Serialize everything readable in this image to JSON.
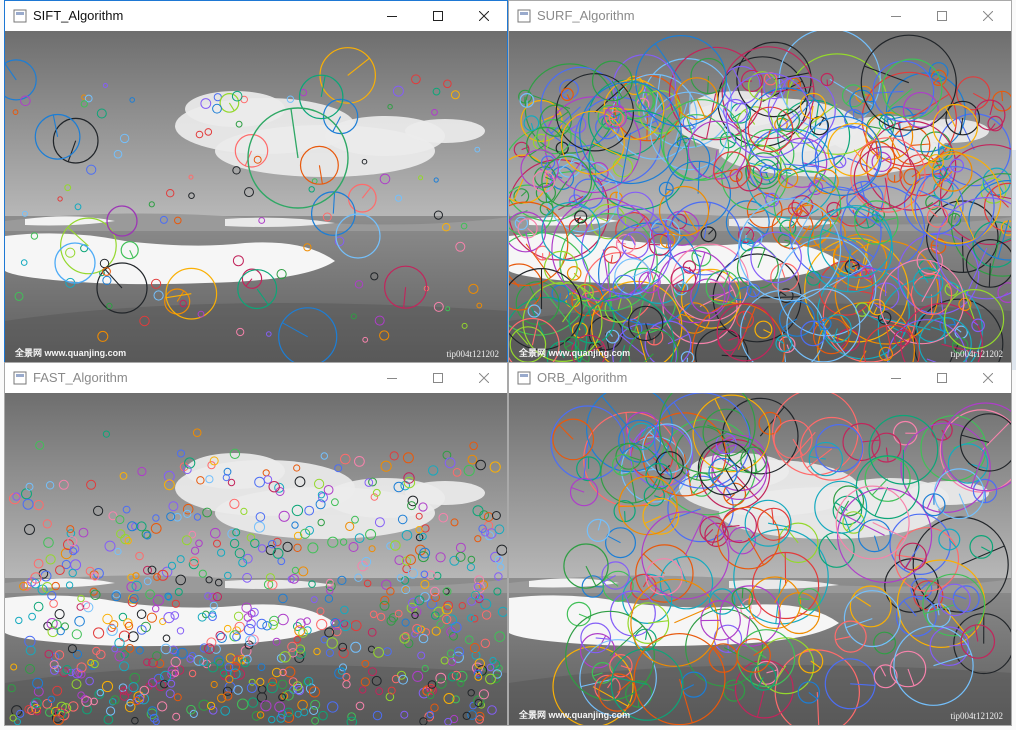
{
  "windows": [
    {
      "key": "sift",
      "title": "SIFT_Algorithm",
      "state": "active",
      "watermark": "全景网 www.quanjing.com",
      "code": "tip004t121202",
      "keypoint_count": 110,
      "keypoint_style": "rich-sparse",
      "seed": 11
    },
    {
      "key": "surf",
      "title": "SURF_Algorithm",
      "state": "inactive",
      "watermark": "全景网 www.quanjing.com",
      "code": "tip004t121202",
      "keypoint_count": 340,
      "keypoint_style": "rich-dense",
      "seed": 23
    },
    {
      "key": "fast",
      "title": "FAST_Algorithm",
      "state": "inactive",
      "watermark": "",
      "code": "",
      "keypoint_count": 720,
      "keypoint_style": "small-circles",
      "seed": 37
    },
    {
      "key": "orb",
      "title": "ORB_Algorithm",
      "state": "inactive",
      "watermark": "全景网 www.quanjing.com",
      "code": "tip004t121202",
      "keypoint_count": 170,
      "keypoint_style": "large-rich",
      "seed": 51
    }
  ],
  "icons": {
    "minimize": "minimize-icon",
    "maximize": "maximize-icon",
    "close": "close-icon",
    "app": "opencv-app-icon"
  },
  "colors": {
    "active_border": "#1e78d4",
    "inactive_border": "#a9a9a9",
    "title_active": "#111111",
    "title_inactive": "#8a8a8a"
  }
}
